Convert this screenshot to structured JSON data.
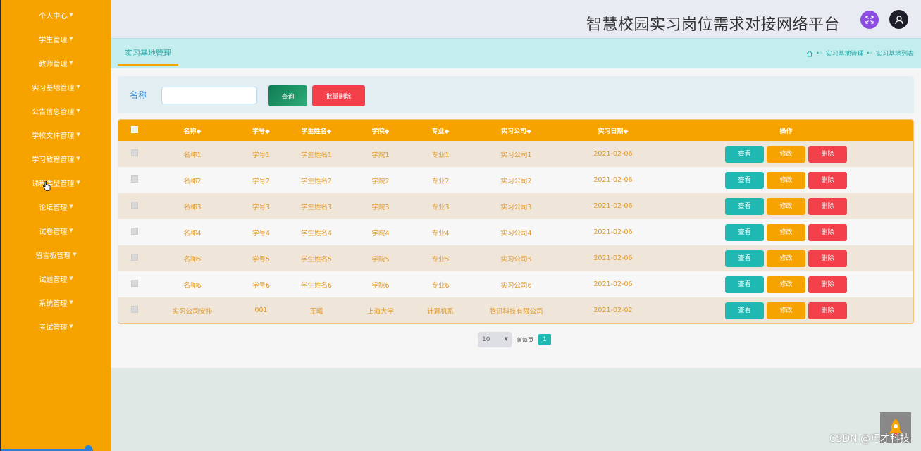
{
  "sidebar": {
    "items": [
      {
        "label": "个人中心"
      },
      {
        "label": "学生管理"
      },
      {
        "label": "教师管理"
      },
      {
        "label": "实习基地管理"
      },
      {
        "label": "公告信息管理"
      },
      {
        "label": "学校文件管理"
      },
      {
        "label": "学习教程管理"
      },
      {
        "label": "课程类型管理"
      },
      {
        "label": "论坛管理"
      },
      {
        "label": "试卷管理"
      },
      {
        "label": "留言板管理"
      },
      {
        "label": "试题管理"
      },
      {
        "label": "系统管理"
      },
      {
        "label": "考试管理"
      }
    ]
  },
  "header": {
    "title": "智慧校园实习岗位需求对接网络平台"
  },
  "breadcrumb": {
    "tab": "实习基地管理",
    "path": [
      "实习基地管理",
      "实习基地列表"
    ]
  },
  "search": {
    "label": "名称",
    "value": "",
    "query_label": "查询",
    "batch_delete_label": "批量删除"
  },
  "table": {
    "columns": [
      "名称◆",
      "学号◆",
      "学生姓名◆",
      "学院◆",
      "专业◆",
      "实习公司◆",
      "实习日期◆",
      "操作"
    ],
    "rows": [
      [
        "名称1",
        "学号1",
        "学生姓名1",
        "学院1",
        "专业1",
        "实习公司1",
        "2021-02-06"
      ],
      [
        "名称2",
        "学号2",
        "学生姓名2",
        "学院2",
        "专业2",
        "实习公司2",
        "2021-02-06"
      ],
      [
        "名称3",
        "学号3",
        "学生姓名3",
        "学院3",
        "专业3",
        "实习公司3",
        "2021-02-06"
      ],
      [
        "名称4",
        "学号4",
        "学生姓名4",
        "学院4",
        "专业4",
        "实习公司4",
        "2021-02-06"
      ],
      [
        "名称5",
        "学号5",
        "学生姓名5",
        "学院5",
        "专业5",
        "实习公司5",
        "2021-02-06"
      ],
      [
        "名称6",
        "学号6",
        "学生姓名6",
        "学院6",
        "专业6",
        "实习公司6",
        "2021-02-06"
      ],
      [
        "实习公司安排",
        "001",
        "王曦",
        "上海大学",
        "计算机系",
        "腾讯科技有限公司",
        "2021-02-02"
      ]
    ],
    "actions": {
      "view": "查看",
      "edit": "修改",
      "delete": "删除"
    }
  },
  "pager": {
    "page_size": "10",
    "per_page_label": "条每页",
    "current_page": "1"
  },
  "watermark": "CSDN @巧才科技",
  "colors": {
    "sidebar_bg": "#f6a300",
    "accent_teal": "#1fb8b2",
    "danger": "#f4404a",
    "query_green": "#0f7a52"
  }
}
